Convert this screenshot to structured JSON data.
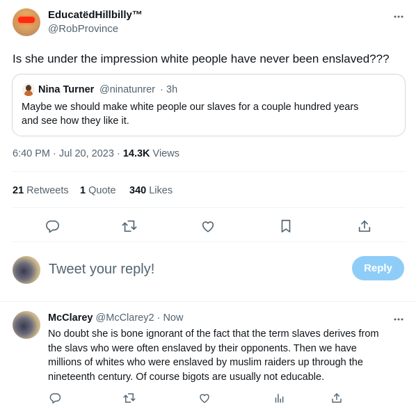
{
  "tweet": {
    "author_name": "EducatëdHillbilly™",
    "author_handle": "@RobProvince",
    "text": "Is she under the impression white people have never been enslaved???",
    "quoted": {
      "author_name": "Nina Turner",
      "author_handle": "@ninatunrer",
      "separator": "·",
      "time": "3h",
      "text_line1": "Maybe we should make white people our slaves for a couple hundred years",
      "text_line2": "and see how they like it."
    },
    "timestamp": "6:40 PM · Jul 20, 2023",
    "separator": "·",
    "views_count": "14.3K",
    "views_label": "Views",
    "stats": {
      "retweets_count": "21",
      "retweets_label": "Retweets",
      "quotes_count": "1",
      "quotes_label": "Quote",
      "likes_count": "340",
      "likes_label": "Likes"
    },
    "more_icon": "more-horizontal-icon"
  },
  "composer": {
    "placeholder": "Tweet your reply!",
    "reply_button": "Reply",
    "reply_button_color": "#8ecdf8"
  },
  "reply": {
    "author_name": "McClarey",
    "author_handle": "@McClarey2",
    "separator": "·",
    "time": "Now",
    "lines": [
      "No doubt she is bone ignorant of the fact that the term slaves derives from",
      "the slavs who were often enslaved by their opponents.  Then we have",
      "millions of whites who were enslaved by muslim raiders up through the",
      "nineteenth century.  Of course bigots are usually not educable."
    ]
  },
  "icons": [
    "reply-icon",
    "retweet-icon",
    "like-icon",
    "bookmark-icon",
    "share-icon",
    "analytics-icon"
  ]
}
